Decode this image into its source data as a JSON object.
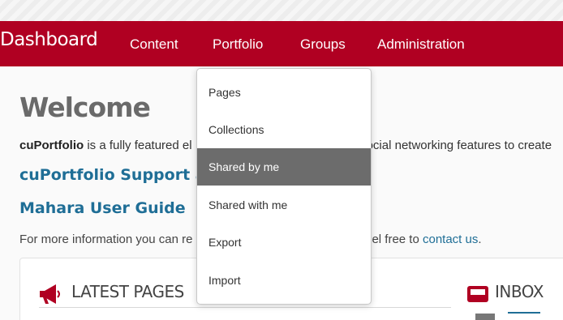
{
  "navbar": {
    "brand": "Dashboard",
    "items": [
      "Content",
      "Portfolio",
      "Groups",
      "Administration"
    ]
  },
  "dropdown": {
    "items": [
      "Pages",
      "Collections",
      "Shared by me",
      "Shared with me",
      "Export",
      "Import"
    ],
    "active": "Shared by me"
  },
  "main": {
    "title": "Welcome",
    "intro_bold": "cuPortfolio",
    "intro_start": " is a fully featured el",
    "intro_end": "ocial networking features to create",
    "support_link": "cuPortfolio Support and",
    "guide_link": "Mahara User Guide",
    "info_start": "For more information you can re",
    "info_end": "e feel free to ",
    "contact_link": "contact us",
    "info_period": "."
  },
  "panels": {
    "latest_pages_title": "LATEST PAGES",
    "inbox_title": "INBOX"
  },
  "colors": {
    "brand_red": "#b00022",
    "link_blue": "#1f6e96",
    "active_item": "#6c6c6c"
  }
}
